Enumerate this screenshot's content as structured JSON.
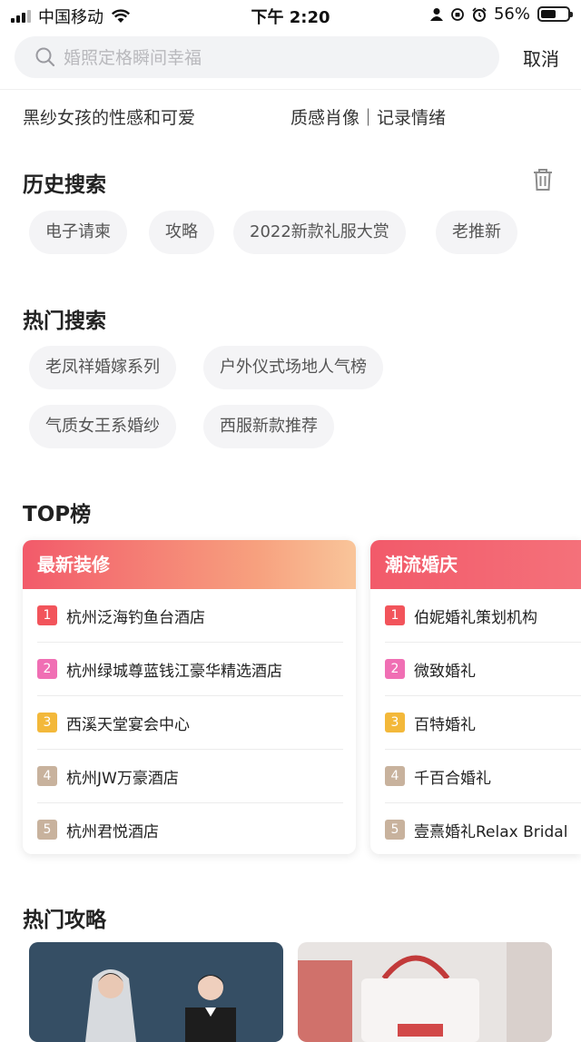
{
  "status": {
    "carrier": "中国移动",
    "time": "下午 2:20",
    "battery": "56%",
    "battery_level": 0.56
  },
  "search": {
    "placeholder": "婚照定格瞬间幸福",
    "cancel_label": "取消"
  },
  "suggestions": [
    "黑纱女孩的性感和可爱",
    "质感肖像｜记录情绪"
  ],
  "history": {
    "title": "历史搜索",
    "items": [
      "电子请柬",
      "攻略",
      "2022新款礼服大赏",
      "老推新"
    ]
  },
  "hot_search": {
    "title": "热门搜索",
    "items": [
      "老凤祥婚嫁系列",
      "户外仪式场地人气榜",
      "气质女王系婚纱",
      "西服新款推荐"
    ]
  },
  "top": {
    "title": "TOP榜",
    "rank_colors": [
      "#f2545b",
      "#f06fb4",
      "#f3b83a",
      "#c8b29d",
      "#c8b29d"
    ],
    "cards": [
      {
        "title": "最新装修",
        "items": [
          "杭州泛海钓鱼台酒店",
          "杭州绿城尊蓝钱江豪华精选酒店",
          "西溪天堂宴会中心",
          "杭州JW万豪酒店",
          "杭州君悦酒店"
        ]
      },
      {
        "title": "潮流婚庆",
        "items": [
          "伯妮婚礼策划机构",
          "微致婚礼",
          "百特婚礼",
          "千百合婚礼",
          "壹熹婚礼Relax Bridal"
        ]
      }
    ],
    "ranks": [
      "1",
      "2",
      "3",
      "4",
      "5"
    ]
  },
  "guides": {
    "title": "热门攻略"
  }
}
